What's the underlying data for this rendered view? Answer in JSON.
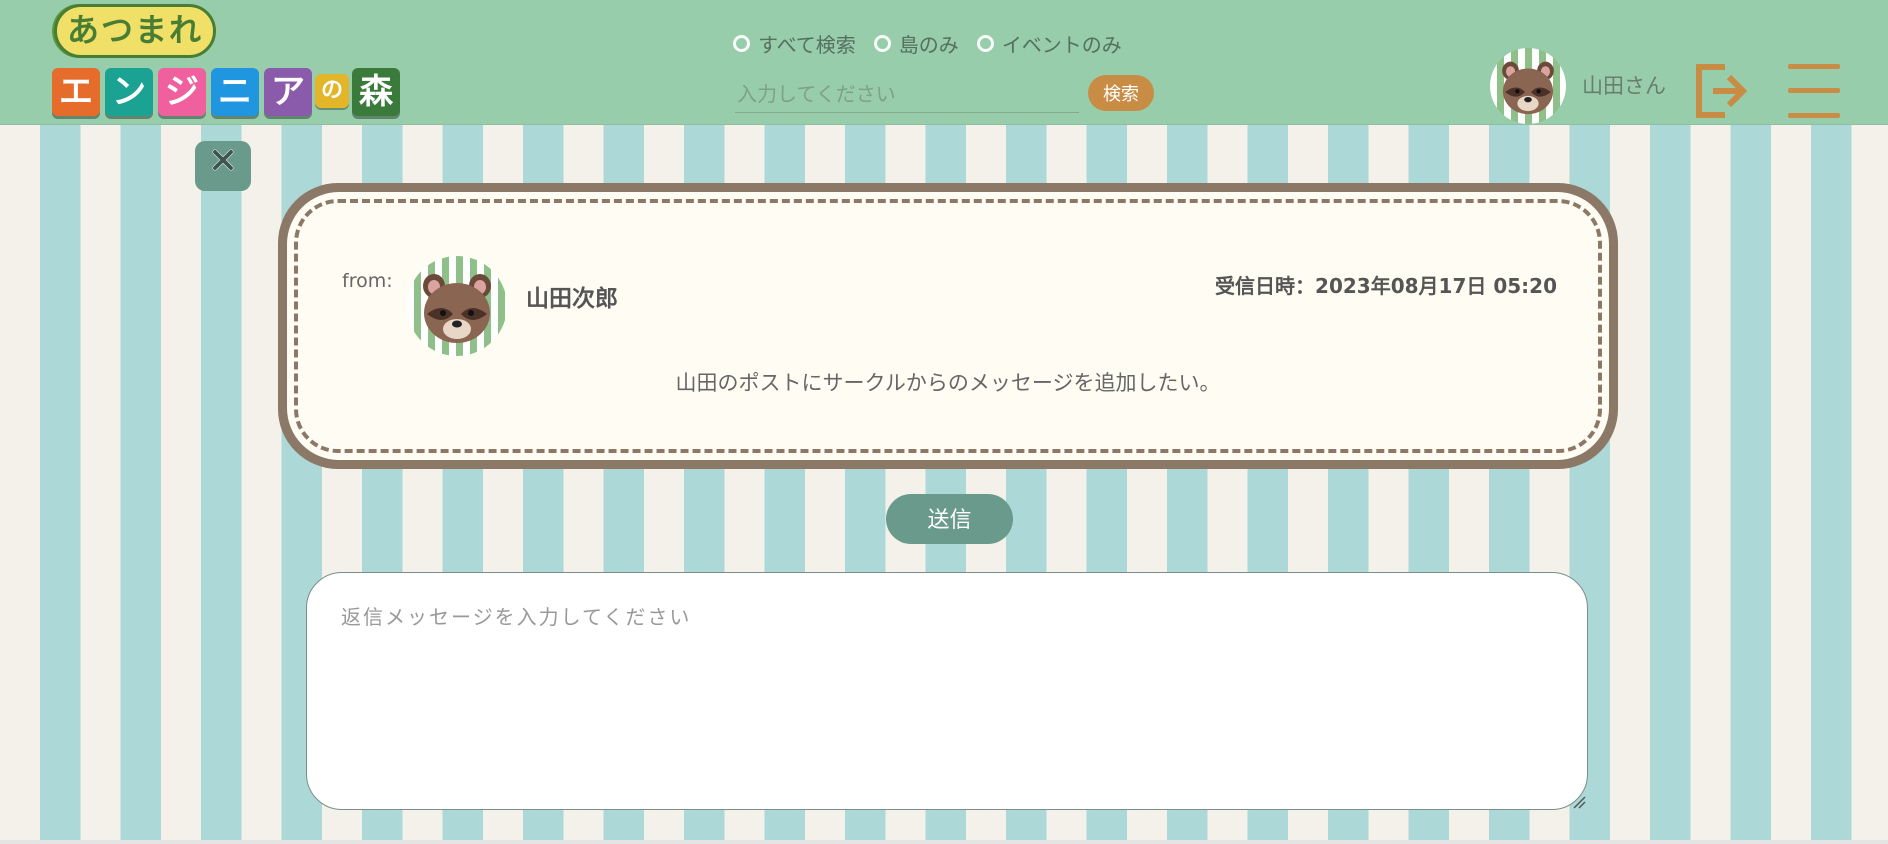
{
  "logo": {
    "top_text": "あつまれ",
    "tiles": [
      {
        "char": "エ",
        "color": "#e66c2c"
      },
      {
        "char": "ン",
        "color": "#1aa393"
      },
      {
        "char": "ジ",
        "color": "#f0609e"
      },
      {
        "char": "ニ",
        "color": "#2196e0"
      },
      {
        "char": "ア",
        "color": "#8a5aab"
      },
      {
        "char": "の",
        "color": "#e3b62a"
      },
      {
        "char": "森",
        "color": "#3a7a3a"
      }
    ]
  },
  "search": {
    "options": [
      "すべて検索",
      "島のみ",
      "イベントのみ"
    ],
    "placeholder": "入力してください",
    "button_label": "検索"
  },
  "user": {
    "name": "山田さん",
    "avatar_icon": "raccoon-dog-icon"
  },
  "colors": {
    "header_bg": "#97cdaa",
    "accent_orange": "#c98c45",
    "button_teal": "#6a9a8b",
    "card_border": "#8c7866",
    "card_bg": "#fffdf3",
    "stripe_light": "#f4f1ea",
    "stripe_teal": "#acd9d7"
  },
  "message": {
    "from_label": "from:",
    "sender_name": "山田次郎",
    "received_label": "受信日時：2023年08月17日 05:20",
    "body": "山田のポストにサークルからのメッセージを追加したい。"
  },
  "reply": {
    "send_label": "送信",
    "placeholder": "返信メッセージを入力してください"
  },
  "icons": {
    "close": "close-icon",
    "logout": "logout-icon",
    "menu": "hamburger-menu-icon"
  }
}
